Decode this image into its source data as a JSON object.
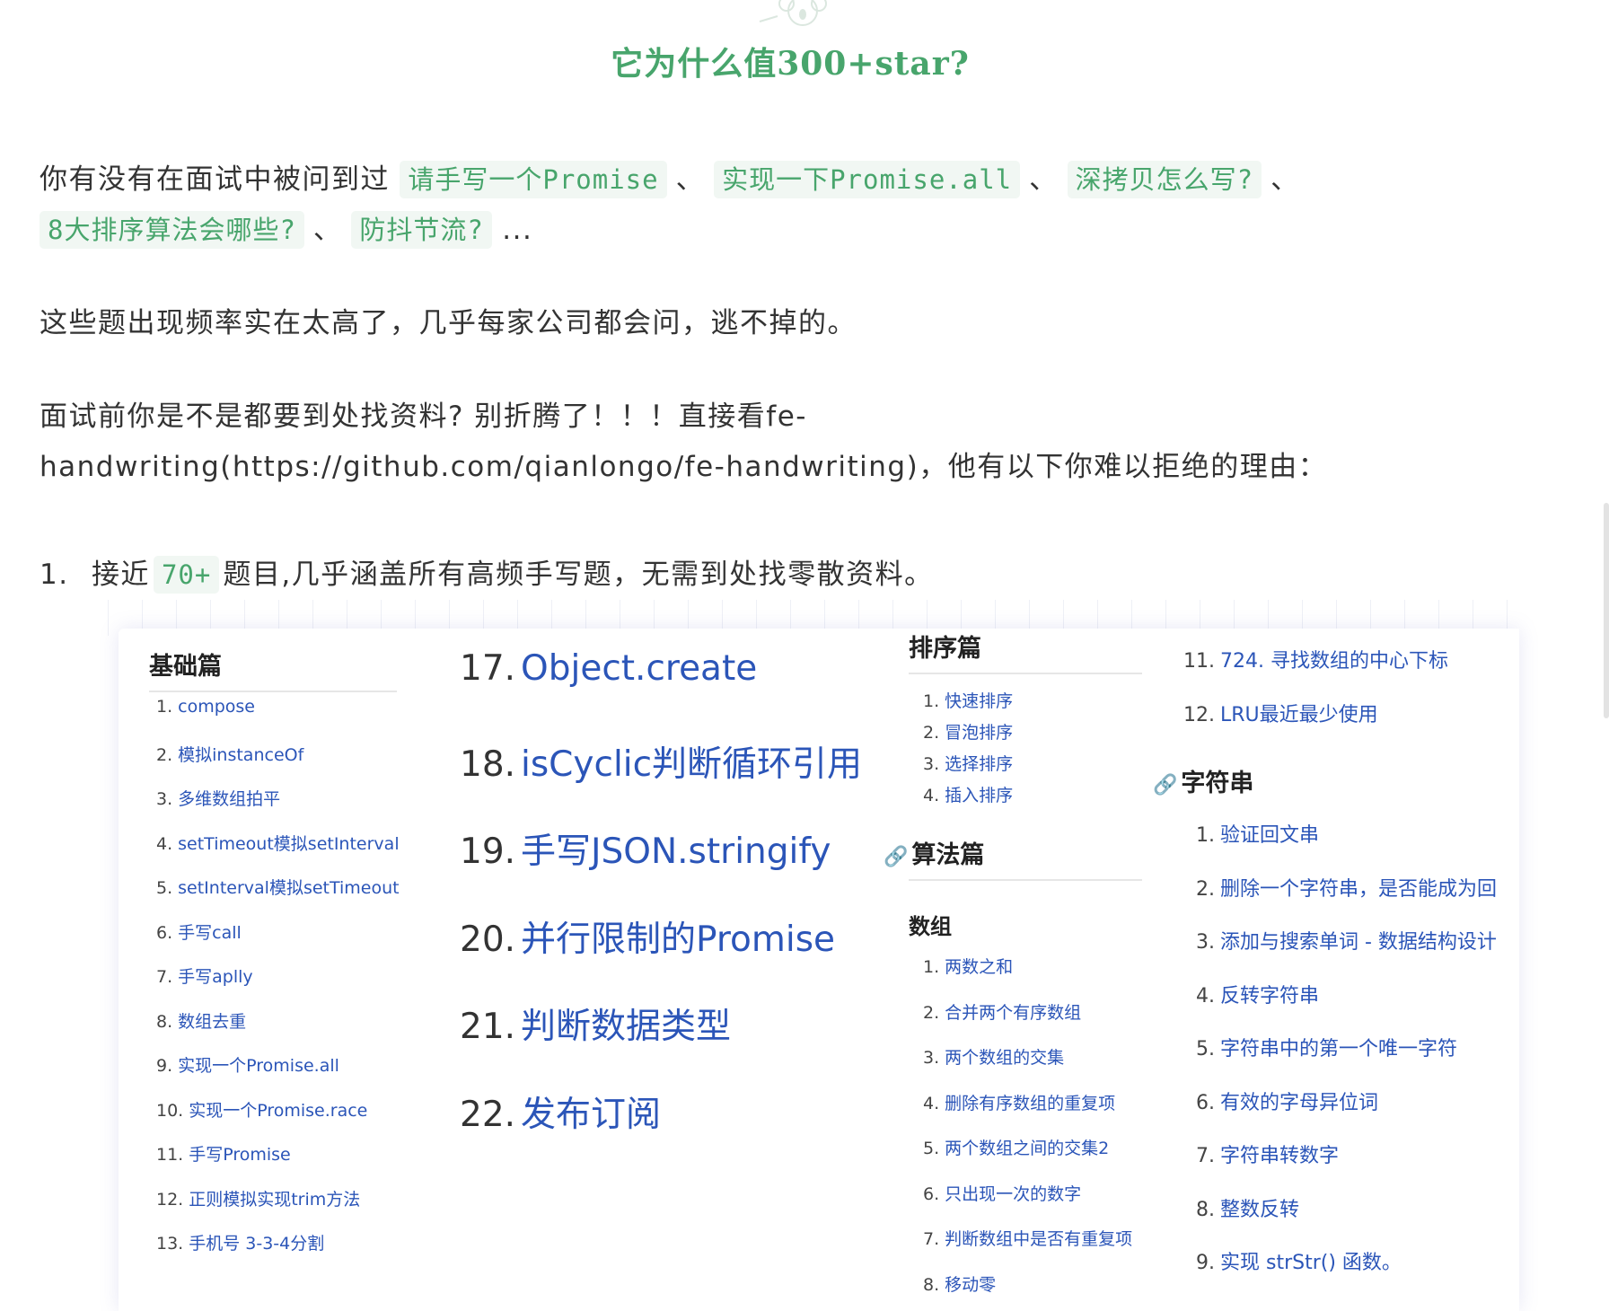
{
  "heading": "它为什么值300+star?",
  "para1": {
    "prefix": "你有没有在面试中被问到过",
    "codes": [
      "请手写一个Promise",
      "实现一下Promise.all",
      "深拷贝怎么写?",
      "8大排序算法会哪些?",
      "防抖节流?"
    ],
    "sep": "、",
    "suffix": "..."
  },
  "para2": "这些题出现频率实在太高了，几乎每家公司都会问，逃不掉的。",
  "para3": "面试前你是不是都要到处找资料? 别折腾了！！！直接看fe-handwriting(https://github.com/qianlongo/fe-handwriting)，他有以下你难以拒绝的理由：",
  "para4": {
    "marker": "1.",
    "before": "接近",
    "code": "70+",
    "after": "题目,几乎涵盖所有高频手写题，无需到处找零散资料。"
  },
  "image": {
    "basics": {
      "title": "基础篇",
      "items": [
        {
          "num": "1.",
          "text": "compose"
        },
        {
          "num": "2.",
          "text": "模拟instanceOf"
        },
        {
          "num": "3.",
          "text": "多维数组拍平"
        },
        {
          "num": "4.",
          "text": "setTimeout模拟setInterval"
        },
        {
          "num": "5.",
          "text": "setInterval模拟setTimeout"
        },
        {
          "num": "6.",
          "text": "手写call"
        },
        {
          "num": "7.",
          "text": "手写aplly"
        },
        {
          "num": "8.",
          "text": "数组去重"
        },
        {
          "num": "9.",
          "text": "实现一个Promise.all"
        },
        {
          "num": "10.",
          "text": "实现一个Promise.race"
        },
        {
          "num": "11.",
          "text": "手写Promise"
        },
        {
          "num": "12.",
          "text": "正则模拟实现trim方法"
        },
        {
          "num": "13.",
          "text": "手机号 3-3-4分割"
        }
      ]
    },
    "big": [
      {
        "num": "17.",
        "text": "Object.create"
      },
      {
        "num": "18.",
        "text": "isCyclic判断循环引用"
      },
      {
        "num": "19.",
        "text": "手写JSON.stringify"
      },
      {
        "num": "20.",
        "text": "并行限制的Promise"
      },
      {
        "num": "21.",
        "text": "判断数据类型"
      },
      {
        "num": "22.",
        "text": "发布订阅"
      }
    ],
    "sort": {
      "title": "排序篇",
      "items": [
        {
          "num": "1.",
          "text": "快速排序"
        },
        {
          "num": "2.",
          "text": "冒泡排序"
        },
        {
          "num": "3.",
          "text": "选择排序"
        },
        {
          "num": "4.",
          "text": "插入排序"
        }
      ]
    },
    "algo": {
      "title": "算法篇",
      "subtitle": "数组",
      "items": [
        {
          "num": "1.",
          "text": "两数之和"
        },
        {
          "num": "2.",
          "text": "合并两个有序数组"
        },
        {
          "num": "3.",
          "text": "两个数组的交集"
        },
        {
          "num": "4.",
          "text": "删除有序数组的重复项"
        },
        {
          "num": "5.",
          "text": "两个数组之间的交集2"
        },
        {
          "num": "6.",
          "text": "只出现一次的数字"
        },
        {
          "num": "7.",
          "text": "判断数组中是否有重复项"
        },
        {
          "num": "8.",
          "text": "移动零"
        }
      ]
    },
    "right": {
      "top_items": [
        {
          "num": "11.",
          "text": "724. 寻找数组的中心下标"
        },
        {
          "num": "12.",
          "text": "LRU最近最少使用"
        }
      ],
      "title": "字符串",
      "items": [
        {
          "num": "1.",
          "text": "验证回文串"
        },
        {
          "num": "2.",
          "text": "删除一个字符串，是否能成为回"
        },
        {
          "num": "3.",
          "text": "添加与搜索单词 - 数据结构设计"
        },
        {
          "num": "4.",
          "text": "反转字符串"
        },
        {
          "num": "5.",
          "text": "字符串中的第一个唯一字符"
        },
        {
          "num": "6.",
          "text": "有效的字母异位词"
        },
        {
          "num": "7.",
          "text": "字符串转数字"
        },
        {
          "num": "8.",
          "text": "整数反转"
        },
        {
          "num": "9.",
          "text": "实现 strStr() 函数。"
        }
      ]
    }
  }
}
